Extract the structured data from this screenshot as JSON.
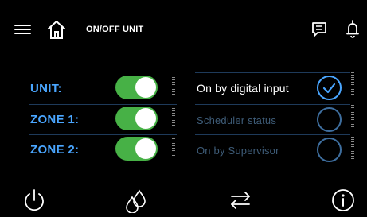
{
  "header": {
    "title": "ON/OFF UNIT",
    "icons": [
      "hamburger-menu-icon",
      "home-icon",
      "message-icon",
      "bell-icon"
    ]
  },
  "units": [
    {
      "label": "UNIT:",
      "state": "on"
    },
    {
      "label": "ZONE 1:",
      "state": "on"
    },
    {
      "label": "ZONE 2:",
      "state": "on"
    }
  ],
  "status": [
    {
      "label": "On by digital input",
      "active": true
    },
    {
      "label": "Scheduler status",
      "active": false
    },
    {
      "label": "On by Supervisor",
      "active": false
    }
  ],
  "footer": {
    "icons": [
      "power-icon",
      "drops-icon",
      "arrows-exchange-icon",
      "info-icon"
    ]
  },
  "colors": {
    "accent": "#4aa6ff",
    "toggle_on": "#47b146",
    "separator": "#1e3a5a",
    "dim_text": "#3e5c78"
  }
}
